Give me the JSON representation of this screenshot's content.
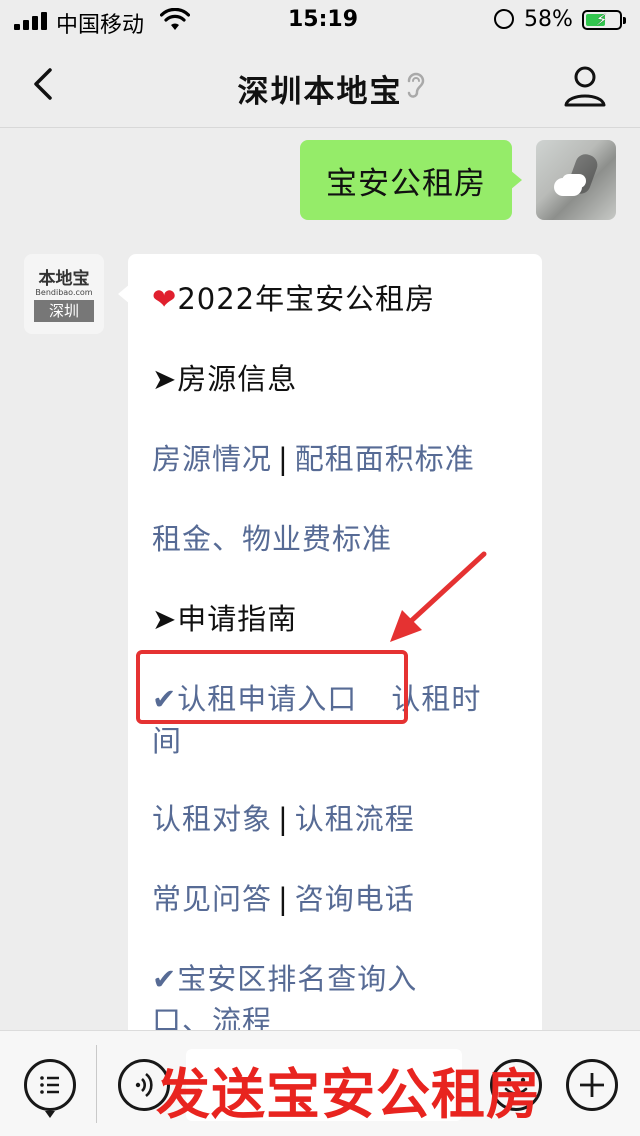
{
  "status_bar": {
    "carrier": "中国移动",
    "time": "15:19",
    "battery_percent": "58%",
    "battery_level": 0.58
  },
  "nav": {
    "title": "深圳本地宝",
    "back_icon": "chevron-left-icon",
    "profile_icon": "person-icon"
  },
  "outgoing_message": {
    "text": "宝安公租房"
  },
  "bot": {
    "avatar_logo": "本地宝",
    "avatar_domain": "Bendibao.com",
    "avatar_city": "深圳"
  },
  "reply": {
    "title": "2022年宝安公租房",
    "section_listing": "➤房源信息",
    "link_listing_status": "房源情况",
    "link_area_standard": "配租面积标准",
    "link_rent_fee": "租金、物业费标准",
    "section_guide": "➤申请指南",
    "link_apply_entry": "✔认租申请入口",
    "link_apply_time_part1": "认租时",
    "link_apply_time_part2": "间",
    "link_target": "认租对象",
    "link_process": "认租流程",
    "link_faq": "常见问答",
    "link_phone": "咨询电话",
    "link_ranking_part1": "✔宝安区排名查询入",
    "link_ranking_part2": "口、流程",
    "separator": "|"
  },
  "overlay_caption": "发送宝安公租房",
  "colors": {
    "outgoing_bubble": "#95ec69",
    "link": "#576b95",
    "highlight": "#e53232",
    "background": "#ededed"
  }
}
